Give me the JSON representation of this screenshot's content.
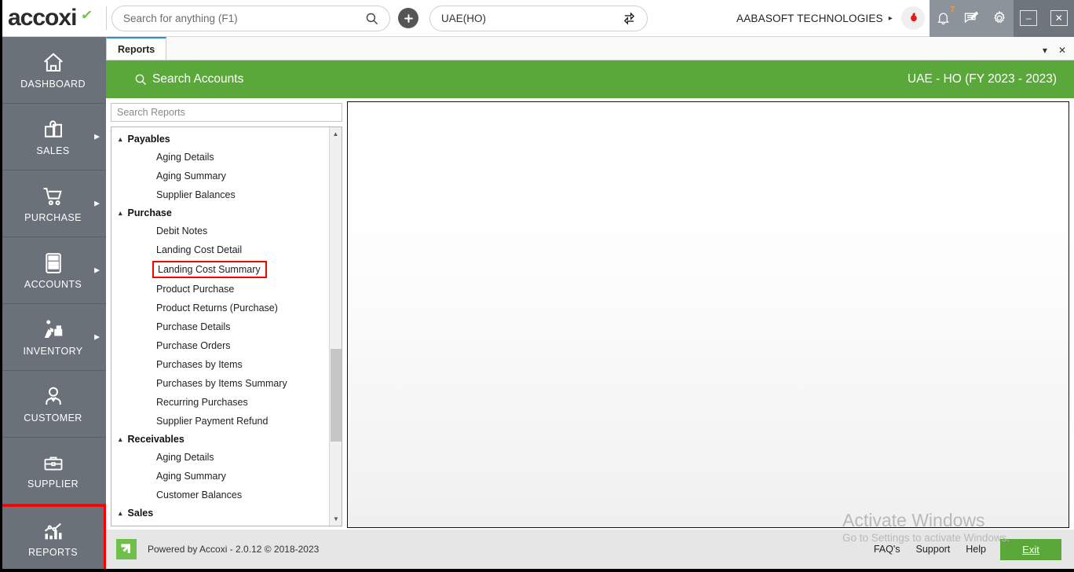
{
  "app": {
    "logo_text": "accoxi",
    "logo_mark": "check-mark"
  },
  "topbar": {
    "search": {
      "value": "",
      "placeholder": "Search for anything (F1)",
      "icon": "search-icon"
    },
    "add_button_icon": "plus-icon",
    "branch": {
      "value": "UAE(HO)",
      "switch_icon": "switch-branch-icon"
    },
    "company_name": "AABASOFT TECHNOLOGIES",
    "company_caret": "▸",
    "avatar_icon": "user-avatar-icon",
    "tray": {
      "notifications": {
        "icon": "bell-icon",
        "count": "7"
      },
      "messages": {
        "icon": "note-edit-icon"
      },
      "settings": {
        "icon": "gear-icon"
      }
    },
    "window": {
      "minimize": "–",
      "close": "✕"
    }
  },
  "sidebar": {
    "items": [
      {
        "label": "DASHBOARD",
        "icon": "home-icon",
        "has_arrow": false,
        "highlighted": false
      },
      {
        "label": "SALES",
        "icon": "shopping-bag-icon",
        "has_arrow": true,
        "highlighted": false
      },
      {
        "label": "PURCHASE",
        "icon": "shopping-cart-icon",
        "has_arrow": true,
        "highlighted": false
      },
      {
        "label": "ACCOUNTS",
        "icon": "calculator-icon",
        "has_arrow": true,
        "highlighted": false
      },
      {
        "label": "INVENTORY",
        "icon": "warehouse-worker-icon",
        "has_arrow": true,
        "highlighted": false
      },
      {
        "label": "CUSTOMER",
        "icon": "person-icon",
        "has_arrow": false,
        "highlighted": false
      },
      {
        "label": "SUPPLIER",
        "icon": "briefcase-icon",
        "has_arrow": false,
        "highlighted": false
      },
      {
        "label": "REPORTS",
        "icon": "bar-chart-icon",
        "has_arrow": false,
        "highlighted": true
      }
    ]
  },
  "tabbar": {
    "tabs": [
      {
        "label": "Reports",
        "active": true
      }
    ],
    "dropdown_icon": "▾",
    "close_icon": "✕"
  },
  "page_header": {
    "search_icon": "search-icon",
    "title": "Search Accounts",
    "fiscal_year": "UAE - HO (FY 2023 - 2023)"
  },
  "reports_panel": {
    "search": {
      "value": "",
      "placeholder": "Search Reports"
    },
    "collapse_icon": "▴",
    "groups": [
      {
        "label": "Payables",
        "expanded": true,
        "items": [
          {
            "label": "Aging Details",
            "marked": false
          },
          {
            "label": "Aging Summary",
            "marked": false
          },
          {
            "label": "Supplier Balances",
            "marked": false
          }
        ]
      },
      {
        "label": "Purchase",
        "expanded": true,
        "items": [
          {
            "label": "Debit Notes",
            "marked": false
          },
          {
            "label": "Landing Cost Detail",
            "marked": false
          },
          {
            "label": "Landing Cost Summary",
            "marked": true
          },
          {
            "label": "Product Purchase",
            "marked": false
          },
          {
            "label": "Product Returns (Purchase)",
            "marked": false
          },
          {
            "label": "Purchase Details",
            "marked": false
          },
          {
            "label": "Purchase Orders",
            "marked": false
          },
          {
            "label": "Purchases by Items",
            "marked": false
          },
          {
            "label": "Purchases by Items Summary",
            "marked": false
          },
          {
            "label": "Recurring Purchases",
            "marked": false
          },
          {
            "label": "Supplier Payment Refund",
            "marked": false
          }
        ]
      },
      {
        "label": "Receivables",
        "expanded": true,
        "items": [
          {
            "label": "Aging Details",
            "marked": false
          },
          {
            "label": "Aging Summary",
            "marked": false
          },
          {
            "label": "Customer Balances",
            "marked": false
          }
        ]
      },
      {
        "label": "Sales",
        "expanded": true,
        "items": []
      }
    ],
    "scrollbar": {
      "up_icon": "▲",
      "down_icon": "▼"
    }
  },
  "watermark": {
    "line1": "Activate Windows",
    "line2": "Go to Settings to activate Windows."
  },
  "footer": {
    "logo_icon": "accoxi-arrow-icon",
    "powered_by": "Powered by Accoxi - 2.0.12 © 2018-2023",
    "links": [
      "FAQ's",
      "Support",
      "Help"
    ],
    "exit_label": "Exit"
  },
  "colors": {
    "brand_green": "#5aa83a",
    "sidebar_gray": "#6b7179",
    "highlight_red": "#fb0000",
    "tray_gray": "#8c939b",
    "tab_accent": "#2a8fd4"
  }
}
